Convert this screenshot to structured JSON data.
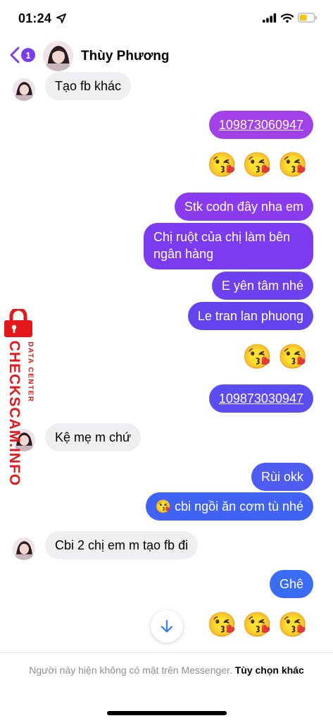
{
  "status_bar": {
    "time": "01:24",
    "battery_color": "#f5c518"
  },
  "header": {
    "back_badge": "1",
    "contact_name": "Thùy Phương",
    "accent": "#7b3cf0"
  },
  "messages": [
    {
      "side": "in",
      "text": "Tạo fb khác"
    },
    {
      "side": "out",
      "text": "109873060947",
      "link": true
    },
    {
      "side": "out",
      "text": "😘😘😘",
      "emoji": true
    },
    {
      "side": "out",
      "text": "Stk codn đây nha em"
    },
    {
      "side": "out",
      "text": "Chị ruột của chị làm bên",
      "text2": "ngân hàng"
    },
    {
      "side": "out",
      "text": "E yên tâm nhé"
    },
    {
      "side": "out",
      "text": "Le tran lan phuong"
    },
    {
      "side": "out",
      "text": "😘😘",
      "emoji": true
    },
    {
      "side": "out",
      "text": "109873030947",
      "link": true
    },
    {
      "side": "in",
      "text": "Kệ mẹ m chứ"
    },
    {
      "side": "out",
      "text": "Rùi okk"
    },
    {
      "side": "out",
      "text": "😘 cbi ngồi ăn cơm tù nhé"
    },
    {
      "side": "in",
      "text": "Cbi 2 chị em m tạo fb đi"
    },
    {
      "side": "out",
      "text": "Ghê"
    },
    {
      "side": "out",
      "text": "😘😘😘",
      "emoji": true
    }
  ],
  "footer": {
    "notice": "Người này hiện không có mặt trên Messenger.",
    "action": "Tùy chọn khác"
  },
  "watermark": {
    "brand": "CHECKSCAM.INFO",
    "sub": "DATA CENTER",
    "color": "#e4171b"
  }
}
